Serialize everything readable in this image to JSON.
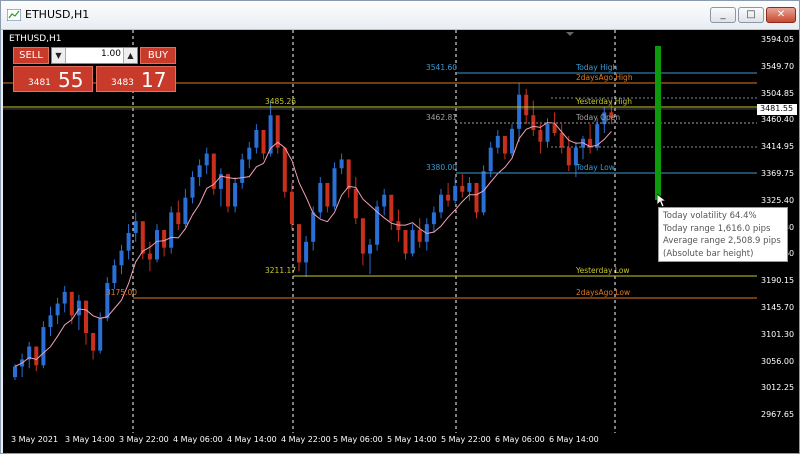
{
  "window": {
    "title": "ETHUSD,H1",
    "min_glyph": "_",
    "max_glyph": "□",
    "close_glyph": "✕"
  },
  "chart": {
    "symbol_label": "ETHUSD,H1"
  },
  "trade_panel": {
    "sell_label": "SELL",
    "buy_label": "BUY",
    "lot": "1.00",
    "lot_down_glyph": "▼",
    "lot_up_glyph": "▲",
    "sell_price_small": "3481",
    "sell_price_big": "55",
    "buy_price_small": "3483",
    "buy_price_big": "17"
  },
  "price_axis": {
    "ticks": [
      "3594.05",
      "3549.70",
      "3504.85",
      "3460.40",
      "3414.95",
      "3369.75",
      "3325.40",
      "3280.30",
      "3235.60",
      "3190.15",
      "3145.70",
      "3101.30",
      "3056.00",
      "3012.25",
      "2967.65"
    ],
    "current_price": "3481.55"
  },
  "time_axis": {
    "ticks": [
      "3 May 2021",
      "3 May 14:00",
      "3 May 22:00",
      "4 May 06:00",
      "4 May 14:00",
      "4 May 22:00",
      "5 May 06:00",
      "5 May 14:00",
      "5 May 22:00",
      "6 May 06:00",
      "6 May 14:00"
    ]
  },
  "levels": [
    {
      "name": "today-high",
      "label": "Today High",
      "price_label": "3541.60",
      "color": "#3c9ad4"
    },
    {
      "name": "two-days-ago-high",
      "label": "2daysAgo High",
      "price_label": "",
      "color": "#e07a20"
    },
    {
      "name": "yesterday-high",
      "label": "Yesterday High",
      "price_label": "3485.26",
      "color": "#c8c828"
    },
    {
      "name": "today-open",
      "label": "Today Open",
      "price_label": "3462.81",
      "color": "#a0a0a0"
    },
    {
      "name": "today-low",
      "label": "Today Low",
      "price_label": "3380.00",
      "color": "#3c9ad4"
    },
    {
      "name": "yesterday-low",
      "label": "Yesterday Low",
      "price_label": "3211.17",
      "color": "#c8c828"
    },
    {
      "name": "two-days-ago-low",
      "label": "2daysAgo Low",
      "price_label": "3175.00",
      "color": "#e07a20"
    }
  ],
  "tooltip": {
    "line1": "Today volatility 64.4%",
    "line2": "Today range 1,616.0 pips",
    "line3": "Average range 2,508.9 pips",
    "line4": "(Absolute bar height)"
  },
  "colors": {
    "bull": "#2a6fd6",
    "bear": "#c8301e",
    "ma": "#f0a0b4",
    "volatility_bar": "#0a9a0a"
  },
  "chart_data": {
    "type": "candlestick",
    "ylim": [
      2945,
      3630
    ],
    "ma_period": "unlabeled",
    "candles": [
      [
        3040,
        3062,
        3035,
        3058
      ],
      [
        3058,
        3080,
        3040,
        3070
      ],
      [
        3070,
        3100,
        3055,
        3092
      ],
      [
        3092,
        3085,
        3050,
        3060
      ],
      [
        3060,
        3135,
        3055,
        3125
      ],
      [
        3125,
        3160,
        3110,
        3145
      ],
      [
        3145,
        3175,
        3130,
        3165
      ],
      [
        3165,
        3195,
        3150,
        3185
      ],
      [
        3185,
        3170,
        3130,
        3145
      ],
      [
        3145,
        3180,
        3120,
        3170
      ],
      [
        3170,
        3120,
        3095,
        3115
      ],
      [
        3115,
        3090,
        3070,
        3085
      ],
      [
        3085,
        3150,
        3080,
        3140
      ],
      [
        3140,
        3210,
        3135,
        3200
      ],
      [
        3200,
        3240,
        3190,
        3230
      ],
      [
        3230,
        3265,
        3215,
        3255
      ],
      [
        3255,
        3300,
        3240,
        3285
      ],
      [
        3285,
        3320,
        3270,
        3305
      ],
      [
        3305,
        3290,
        3240,
        3250
      ],
      [
        3250,
        3270,
        3220,
        3240
      ],
      [
        3240,
        3300,
        3235,
        3290
      ],
      [
        3290,
        3280,
        3245,
        3260
      ],
      [
        3260,
        3330,
        3250,
        3320
      ],
      [
        3320,
        3340,
        3290,
        3300
      ],
      [
        3300,
        3360,
        3295,
        3345
      ],
      [
        3345,
        3390,
        3335,
        3380
      ],
      [
        3380,
        3410,
        3365,
        3400
      ],
      [
        3400,
        3430,
        3385,
        3420
      ],
      [
        3420,
        3405,
        3350,
        3360
      ],
      [
        3360,
        3395,
        3330,
        3385
      ],
      [
        3385,
        3365,
        3320,
        3330
      ],
      [
        3330,
        3380,
        3320,
        3370
      ],
      [
        3370,
        3420,
        3360,
        3410
      ],
      [
        3410,
        3440,
        3395,
        3430
      ],
      [
        3430,
        3470,
        3420,
        3460
      ],
      [
        3460,
        3455,
        3410,
        3420
      ],
      [
        3420,
        3510,
        3415,
        3485
      ],
      [
        3485,
        3470,
        3420,
        3430
      ],
      [
        3430,
        3420,
        3345,
        3355
      ],
      [
        3355,
        3370,
        3290,
        3300
      ],
      [
        3300,
        3285,
        3220,
        3235
      ],
      [
        3235,
        3280,
        3210,
        3270
      ],
      [
        3270,
        3330,
        3255,
        3320
      ],
      [
        3320,
        3380,
        3310,
        3370
      ],
      [
        3370,
        3360,
        3320,
        3330
      ],
      [
        3330,
        3405,
        3325,
        3395
      ],
      [
        3395,
        3420,
        3385,
        3410
      ],
      [
        3410,
        3400,
        3345,
        3360
      ],
      [
        3360,
        3380,
        3300,
        3310
      ],
      [
        3310,
        3295,
        3230,
        3250
      ],
      [
        3250,
        3275,
        3215,
        3265
      ],
      [
        3265,
        3340,
        3255,
        3330
      ],
      [
        3330,
        3360,
        3315,
        3350
      ],
      [
        3350,
        3335,
        3290,
        3305
      ],
      [
        3305,
        3325,
        3270,
        3290
      ],
      [
        3290,
        3280,
        3240,
        3250
      ],
      [
        3250,
        3300,
        3245,
        3290
      ],
      [
        3290,
        3310,
        3260,
        3270
      ],
      [
        3270,
        3310,
        3255,
        3300
      ],
      [
        3300,
        3330,
        3285,
        3320
      ],
      [
        3320,
        3360,
        3310,
        3350
      ],
      [
        3350,
        3370,
        3330,
        3340
      ],
      [
        3340,
        3380,
        3335,
        3365
      ],
      [
        3365,
        3385,
        3345,
        3355
      ],
      [
        3355,
        3380,
        3340,
        3370
      ],
      [
        3370,
        3365,
        3310,
        3320
      ],
      [
        3320,
        3400,
        3315,
        3390
      ],
      [
        3390,
        3440,
        3380,
        3430
      ],
      [
        3430,
        3460,
        3420,
        3450
      ],
      [
        3450,
        3440,
        3410,
        3420
      ],
      [
        3420,
        3470,
        3415,
        3462
      ],
      [
        3462,
        3541,
        3440,
        3520
      ],
      [
        3520,
        3530,
        3470,
        3485
      ],
      [
        3485,
        3510,
        3450,
        3460
      ],
      [
        3460,
        3470,
        3420,
        3440
      ],
      [
        3440,
        3480,
        3430,
        3470
      ],
      [
        3470,
        3490,
        3450,
        3455
      ],
      [
        3455,
        3470,
        3420,
        3430
      ],
      [
        3430,
        3450,
        3390,
        3400
      ],
      [
        3400,
        3440,
        3380,
        3430
      ],
      [
        3430,
        3450,
        3410,
        3445
      ],
      [
        3445,
        3470,
        3420,
        3430
      ],
      [
        3430,
        3480,
        3425,
        3470
      ],
      [
        3470,
        3500,
        3455,
        3490
      ],
      [
        3490,
        3510,
        3470,
        3481
      ]
    ]
  }
}
